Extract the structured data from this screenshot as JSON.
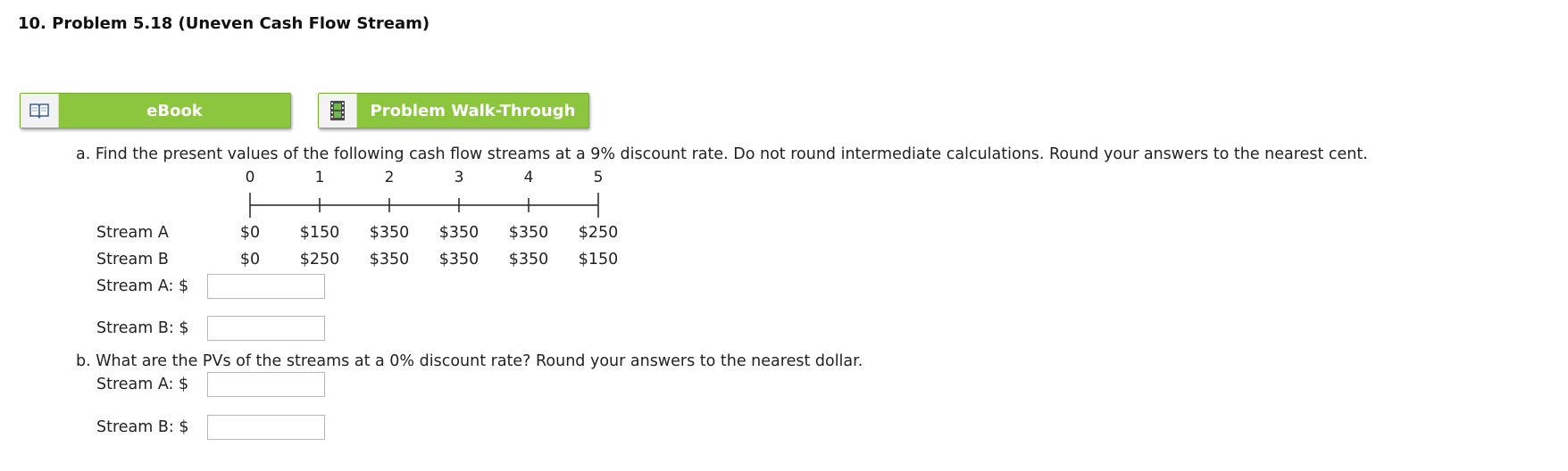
{
  "header": {
    "title": "10.  Problem 5.18 (Uneven Cash Flow Stream)"
  },
  "buttons": {
    "ebook": {
      "label": "eBook",
      "icon": "book-icon"
    },
    "walkthrough": {
      "label": "Problem Walk-Through",
      "icon": "film-icon"
    }
  },
  "part_a": {
    "question": "a. Find the present values of the following cash flow streams at a 9% discount rate. Do not round intermediate calculations. Round your answers to the nearest cent.",
    "timeline_periods": [
      "0",
      "1",
      "2",
      "3",
      "4",
      "5"
    ],
    "streams": [
      {
        "label": "Stream A",
        "values": [
          "$0",
          "$150",
          "$350",
          "$350",
          "$350",
          "$250"
        ]
      },
      {
        "label": "Stream B",
        "values": [
          "$0",
          "$250",
          "$350",
          "$350",
          "$350",
          "$150"
        ]
      }
    ],
    "answers": [
      {
        "label": "Stream A: $",
        "value": ""
      },
      {
        "label": "Stream B: $",
        "value": ""
      }
    ]
  },
  "part_b": {
    "question": "b. What are the PVs of the streams at a 0% discount rate? Round your answers to the nearest dollar.",
    "answers": [
      {
        "label": "Stream A: $",
        "value": ""
      },
      {
        "label": "Stream B: $",
        "value": ""
      }
    ]
  }
}
